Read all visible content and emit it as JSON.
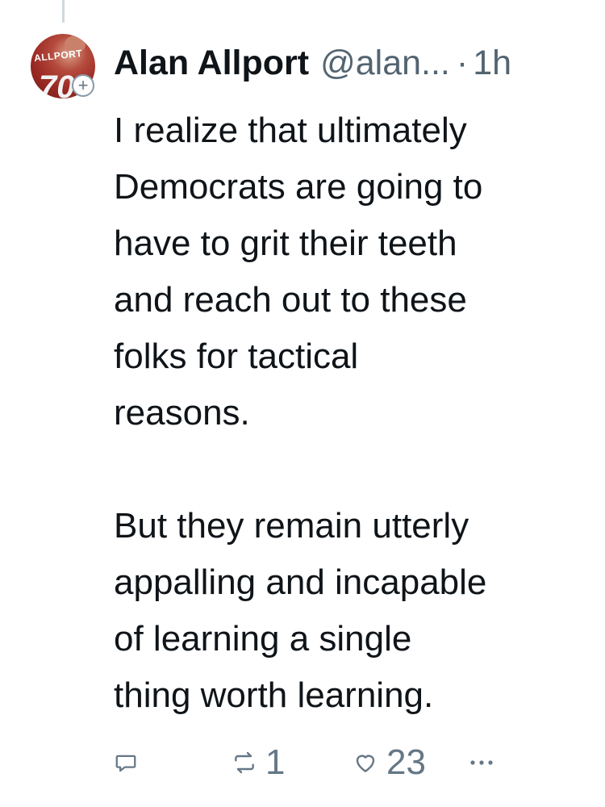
{
  "author": {
    "name": "Alan Allport",
    "handle": "@alan...",
    "separator": "·",
    "time": "1h",
    "avatar_jersey_text": "ALLPORT",
    "avatar_jersey_number": "70",
    "follow_badge": "+"
  },
  "tweet": {
    "text": "I realize that ultimately\nDemocrats are going to\nhave to grit their teeth\nand reach out to these\nfolks for tactical\nreasons.\n\nBut they remain utterly\nappalling and incapable\nof learning a single\nthing worth learning."
  },
  "actions": {
    "reply_icon": "reply-icon",
    "retweet_icon": "retweet-icon",
    "retweet_count": "1",
    "like_icon": "heart-icon",
    "like_count": "23",
    "more_icon": "more-icon"
  },
  "colors": {
    "text": "#0f1419",
    "secondary": "#536471",
    "icon": "#657786",
    "thread_line": "#cfd9de"
  }
}
